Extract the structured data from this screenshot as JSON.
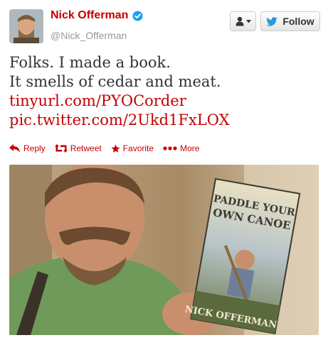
{
  "tweet": {
    "author_name": "Nick Offerman",
    "handle": "@Nick_Offerman",
    "lines": [
      "Folks. I made a book.",
      "It smells of cedar and meat."
    ],
    "links": [
      "tinyurl.com/PYOCorder",
      "pic.twitter.com/2Ukd1FxLOX"
    ]
  },
  "buttons": {
    "follow_label": "Follow"
  },
  "actions": {
    "reply": "Reply",
    "retweet": "Retweet",
    "favorite": "Favorite",
    "more": "More"
  },
  "photo": {
    "book_title_1": "PADDLE YOUR",
    "book_title_2": "OWN CANOE",
    "book_author": "NICK OFFERMAN"
  },
  "colors": {
    "accent": "#c40000",
    "verified": "#1da1f2",
    "twitter_bird": "#2b9bd8"
  }
}
